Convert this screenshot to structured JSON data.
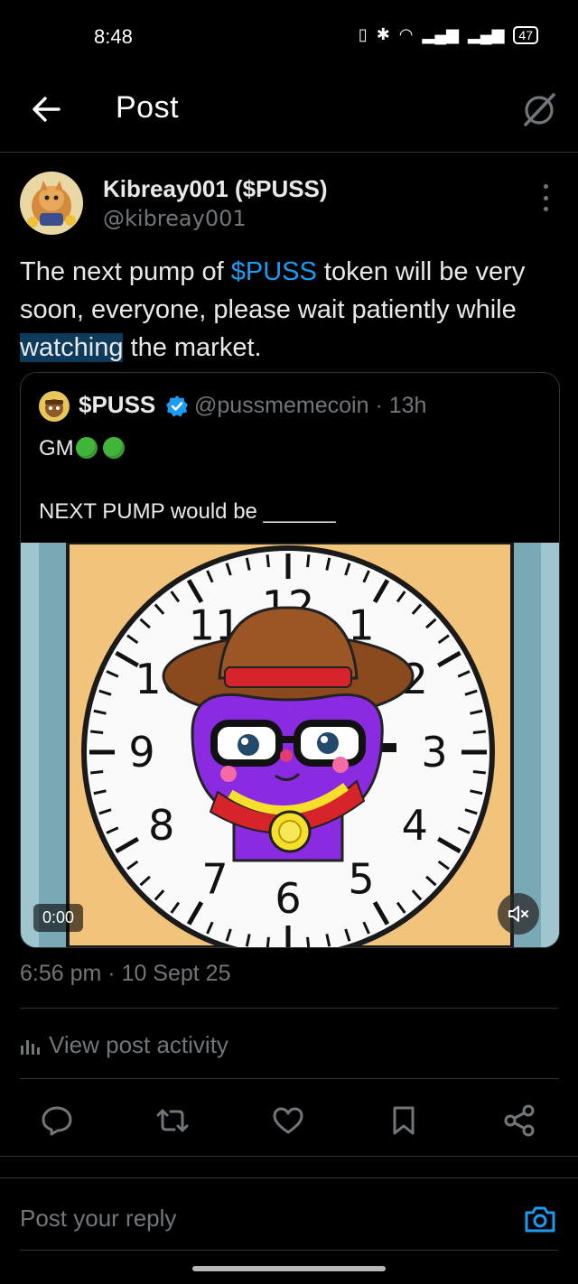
{
  "status_bar": {
    "time": "8:48",
    "battery": "47"
  },
  "header": {
    "title": "Post"
  },
  "author": {
    "name": "Kibreay001 ($PUSS)",
    "handle": "@kibreay001"
  },
  "post": {
    "text_before": "The next pump of ",
    "cashtag": "$PUSS",
    "text_middle": " token will be very soon, everyone, please wait patiently while ",
    "highlighted": "watching",
    "text_after": " the market."
  },
  "quote": {
    "name": "$PUSS",
    "handle": "@pussmemecoin · 13h",
    "line1": "GM",
    "line2": "NEXT PUMP would be ______",
    "video": {
      "time": "0:00",
      "clock_numbers": [
        "12",
        "1",
        "2",
        "3",
        "4",
        "5",
        "6",
        "7",
        "8",
        "9",
        "10",
        "11"
      ]
    }
  },
  "meta": {
    "timestamp": "6:56 pm · 10 Sept 25",
    "activity_label": "View post activity"
  },
  "actions": [
    "reply-icon",
    "repost-icon",
    "like-icon",
    "bookmark-icon",
    "share-icon"
  ],
  "reply": {
    "placeholder": "Post your reply"
  },
  "colors": {
    "accent": "#1d9bf0",
    "text": "#e7e9ea",
    "muted": "#71767b",
    "border": "#2f3336",
    "verified": "#1d9bf0"
  }
}
